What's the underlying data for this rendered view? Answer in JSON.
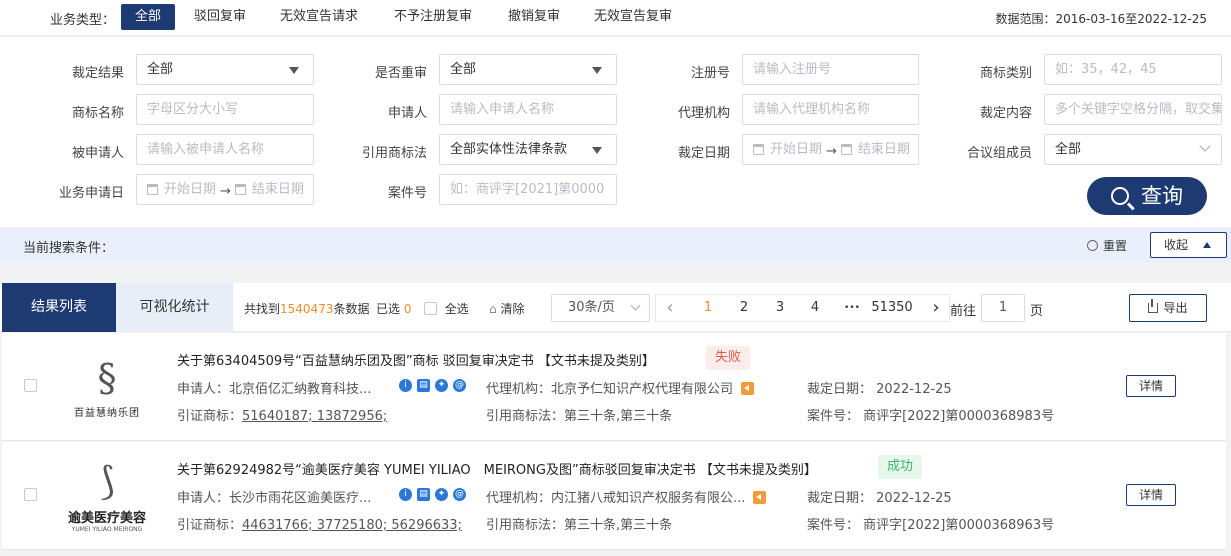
{
  "topbar": {
    "label": "业务类型：",
    "tabs": [
      "全部",
      "驳回复审",
      "无效宣告请求",
      "不予注册复审",
      "撤销复审",
      "无效宣告复审"
    ],
    "range": "数据范围：2016-03-16至2022-12-25"
  },
  "filters": {
    "result_label": "裁定结果",
    "result_value": "全部",
    "reexam_label": "是否重审",
    "reexam_value": "全部",
    "regno_label": "注册号",
    "regno_ph": "请输入注册号",
    "class_label": "商标类别",
    "class_ph": "如：35，42，45",
    "tmname_label": "商标名称",
    "tmname_ph": "字母区分大小写",
    "applicant_label": "申请人",
    "applicant_ph": "请输入申请人名称",
    "agency_label": "代理机构",
    "agency_ph": "请输入代理机构名称",
    "content_label": "裁定内容",
    "content_ph": "多个关键字空格分隔，取交集",
    "respondent_label": "被申请人",
    "respondent_ph": "请输入被申请人名称",
    "law_label": "引用商标法",
    "law_value": "全部实体性法律条款",
    "ruledate_label": "裁定日期",
    "ruledate_start": "开始日期",
    "ruledate_arrow": "→",
    "ruledate_end": "结束日期",
    "panel_label": "合议组成员",
    "panel_value": "全部",
    "appdate_label": "业务申请日",
    "appdate_start": "开始日期",
    "appdate_arrow": "→",
    "appdate_end": "结束日期",
    "caseno_label": "案件号",
    "caseno_ph": "如：商评字[2021]第0000",
    "search_label": "查询"
  },
  "cond": {
    "title": "当前搜索条件：",
    "reset": "重置",
    "collapse": "收起"
  },
  "results_header": {
    "tab_list": "结果列表",
    "tab_vis": "可视化统计",
    "found_pre": "共找到",
    "found_count": "1540473",
    "found_post": "条数据",
    "selected_pre": "已选",
    "selected_count": "0",
    "select_all": "全选",
    "clear": "清除",
    "page_size": "30条/页",
    "prev": "‹",
    "pages": [
      "1",
      "2",
      "3",
      "4"
    ],
    "ellipsis": "•••",
    "last": "51350",
    "next": "›",
    "goto_pre": "前往",
    "goto_value": "1",
    "goto_post": "页",
    "export": "导出"
  },
  "rows": [
    {
      "logo_mark": "§",
      "logo_text": "百益慧纳乐团",
      "title": "关于第63404509号“百益慧纳乐团及图”商标 驳回复审决定书 【文书未提及类别】",
      "status": "失败",
      "applicant_label": "申请人：",
      "applicant": "北京佰亿汇纳教育科技...",
      "agency_label": "代理机构：",
      "agency": "北京予仁知识产权代理有限公司",
      "date_label": "裁定日期：",
      "date": "2022-12-25",
      "cited_label": "引证商标：",
      "cited": "51640187; 13872956;",
      "law_label": "引用商标法：",
      "law": "第三十条,第三十条",
      "case_label": "案件号：",
      "case": "商评字[2022]第0000368983号",
      "detail": "详情"
    },
    {
      "logo_mark": "⟆",
      "logo_text": "逾美医疗美容",
      "logo_sub": "YUMEI YILIAO MEIRONG",
      "title": "关于第62924982号“逾美医疗美容 YUMEI YILIAO　MEIRONG及图”商标驳回复审决定书 【文书未提及类别】",
      "status": "成功",
      "applicant_label": "申请人：",
      "applicant": "长沙市雨花区逾美医疗...",
      "agency_label": "代理机构：",
      "agency": "内江猪八戒知识产权服务有限公...",
      "date_label": "裁定日期：",
      "date": "2022-12-25",
      "cited_label": "引证商标：",
      "cited": "44631766; 37725180; 56296633;",
      "law_label": "引用商标法：",
      "law": "第三十条,第三十条",
      "case_label": "案件号：",
      "case": "商评字[2022]第0000368963号",
      "detail": "详情"
    }
  ],
  "colors": {
    "primary": "#1e3a73",
    "accent": "#f08c2e",
    "fail": "#e8584a",
    "success": "#3bb56a"
  }
}
